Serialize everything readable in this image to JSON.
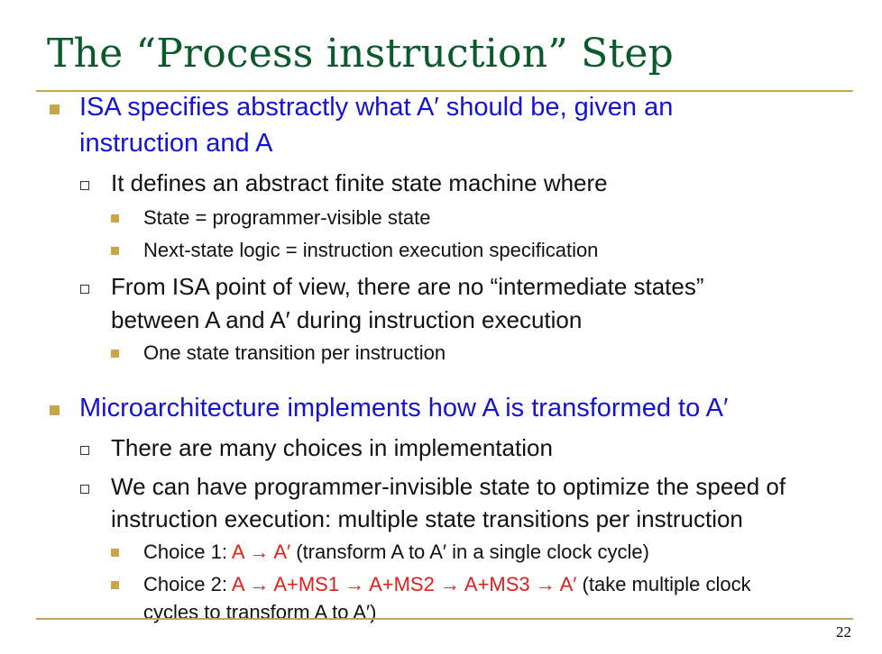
{
  "title": "The “Process instruction” Step",
  "page_number": "22",
  "sections": [
    {
      "text_line1": "ISA specifies abstractly what A′ should be, given an",
      "text_line2": "instruction and A",
      "points": [
        {
          "text": "It defines an abstract finite state machine where",
          "subs": [
            "State = programmer-visible state",
            "Next-state logic = instruction execution specification"
          ]
        },
        {
          "text_line1": "From ISA point of view, there are no “intermediate states”",
          "text_line2": "between A and A′ during instruction execution",
          "subs": [
            "One state transition per instruction"
          ]
        }
      ]
    },
    {
      "text": "Microarchitecture implements how A is transformed to A′",
      "points": [
        {
          "text": "There are many choices in implementation"
        },
        {
          "text_line1": "We can have programmer-invisible state to optimize the speed of",
          "text_line2": "instruction execution: multiple state transitions per instruction",
          "choices": [
            {
              "label": "Choice 1: ",
              "highlight": "A → A′",
              "rest": " (transform A to A′ in a single clock cycle)"
            },
            {
              "label": "Choice 2: ",
              "highlight": "A → A+MS1 → A+MS2 → A+MS3 → A′",
              "rest": " (take multiple clock",
              "continuation": "cycles to transform A to A′)"
            }
          ]
        }
      ]
    }
  ],
  "colors": {
    "title": "#0b5a2c",
    "level1_text": "#1414d0",
    "accent_gold": "#c8a64a",
    "highlight_red": "#e0201c"
  }
}
